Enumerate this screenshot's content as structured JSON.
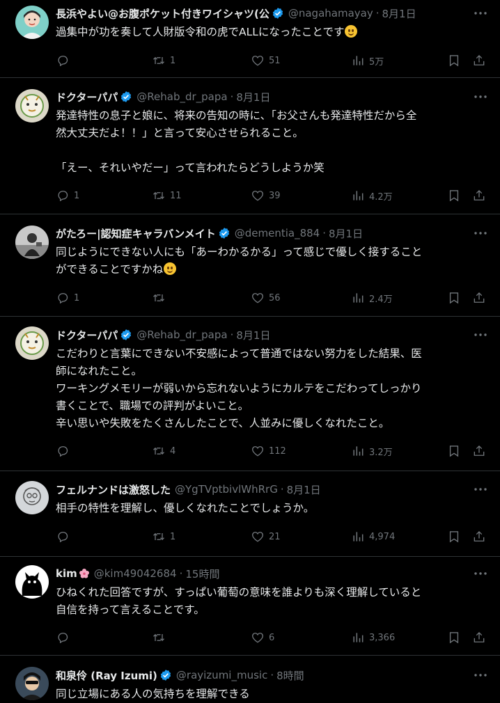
{
  "tweets": [
    {
      "name": "長浜やよい@お腹ポケット付きワイシャツ(公",
      "handle": "@nagahamayay",
      "time": "8月1日",
      "lines": [
        "過集中が功を奏して人財版令和の虎でALLになったことです"
      ],
      "emoji": "smile",
      "verified": true,
      "reply": "",
      "retweet": "1",
      "like": "51",
      "views": "5万"
    },
    {
      "name": "ドクターパパ",
      "handle": "@Rehab_dr_papa",
      "time": "8月1日",
      "lines": [
        "発達特性の息子と娘に、将来の告知の時に、「お父さんも発達特性だから全",
        "然大丈夫だよ！！」と言って安心させられること。",
        "",
        "「えー、それいやだー」って言われたらどうしようか笑"
      ],
      "verified": true,
      "reply": "1",
      "retweet": "11",
      "like": "39",
      "views": "4.2万"
    },
    {
      "name": "がたろー|認知症キャラバンメイト",
      "handle": "@dementia_884",
      "time": "8月1日",
      "lines": [
        "同じようにできない人にも「あーわかるかる」って感じで優しく接すること",
        "ができることですかね"
      ],
      "emoji": "blush",
      "verified": true,
      "reply": "1",
      "retweet": "",
      "like": "56",
      "views": "2.4万"
    },
    {
      "name": "ドクターパパ",
      "handle": "@Rehab_dr_papa",
      "time": "8月1日",
      "lines": [
        "こだわりと言葉にできない不安感によって普通ではない努力をした結果、医",
        "師になれたこと。",
        "ワーキングメモリーが弱いから忘れないようにカルテをこだわってしっかり",
        "書くことで、職場での評判がよいこと。",
        "辛い思いや失敗をたくさんしたことで、人並みに優しくなれたこと。"
      ],
      "verified": true,
      "reply": "",
      "retweet": "4",
      "like": "112",
      "views": "3.2万"
    },
    {
      "name": "フェルナンドは激怒した",
      "handle": "@YgTVptbivlWhRrG",
      "time": "8月1日",
      "lines": [
        "相手の特性を理解し、優しくなれたことでしょうか。"
      ],
      "verified": false,
      "reply": "",
      "retweet": "1",
      "like": "21",
      "views": "4,974"
    },
    {
      "name": "kim",
      "handle": "@kim49042684",
      "time": "15時間",
      "lines": [
        "ひねくれた回答ですが、すっぱい葡萄の意味を誰よりも深く理解していると",
        "自信を持って言えることです。"
      ],
      "verified": false,
      "reply": "",
      "retweet": "",
      "like": "6",
      "views": "3,366"
    },
    {
      "name": "和泉伶 (Ray Izumi)",
      "handle": "@rayizumi_music",
      "time": "8時間",
      "lines": [
        "同じ立場にある人の気持ちを理解できる"
      ],
      "verified": true,
      "reply": "",
      "retweet": "",
      "like": "",
      "views": ""
    }
  ],
  "separator": "·",
  "icons": {
    "reply": "reply-icon",
    "retweet": "retweet-icon",
    "like": "heart-icon",
    "views": "views-icon",
    "bookmark": "bookmark-icon",
    "share": "share-icon",
    "more": "more-icon",
    "verified": "verified-badge-icon"
  },
  "colors": {
    "background": "#000000",
    "text": "#e7e9ea",
    "muted": "#71767b",
    "verified": "#1d9bf0",
    "divider": "#2f3336"
  }
}
